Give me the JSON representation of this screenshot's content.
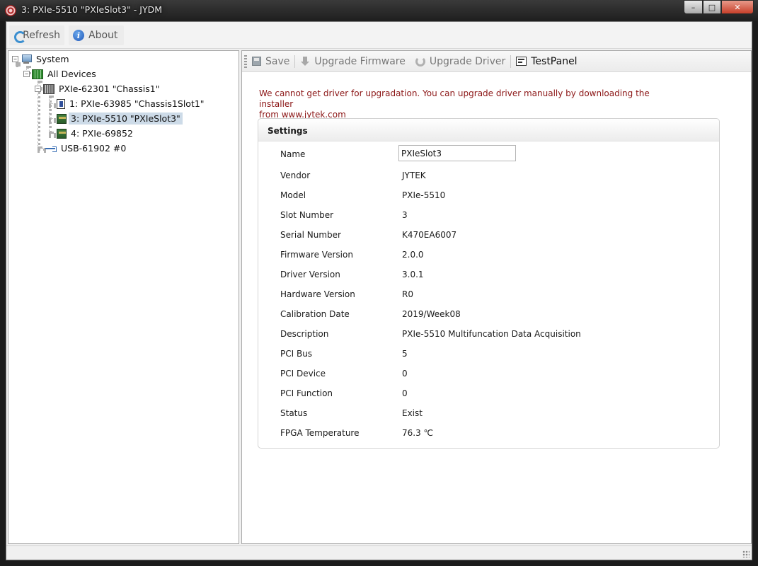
{
  "window": {
    "title": "3: PXIe-5510 \"PXIeSlot3\" - JYDM",
    "controls": {
      "minimize": "–",
      "maximize": "□",
      "close": "✕"
    }
  },
  "toolbar": {
    "refresh_label": "Refresh",
    "about_label": "About"
  },
  "tree": {
    "system": "System",
    "all_devices": "All Devices",
    "chassis": "PXIe-62301 \"Chassis1\"",
    "slot1": "1: PXIe-63985 \"Chassis1Slot1\"",
    "slot3": "3: PXIe-5510 \"PXIeSlot3\"",
    "slot4": "4: PXIe-69852",
    "usb": "USB-61902 #0",
    "expand_open": "−"
  },
  "device_toolbar": {
    "save_label": "Save",
    "upgrade_firmware_label": "Upgrade Firmware",
    "upgrade_driver_label": "Upgrade Driver",
    "testpanel_label": "TestPanel"
  },
  "warning": {
    "line1": "We cannot get driver for upgradation. You can upgrade driver manually by downloading the installer",
    "line2": "from www.jytek.com"
  },
  "settings": {
    "header": "Settings",
    "name_label": "Name",
    "name_value": "PXIeSlot3",
    "rows": [
      {
        "key": "Vendor",
        "value": "JYTEK"
      },
      {
        "key": "Model",
        "value": "PXIe-5510"
      },
      {
        "key": "Slot Number",
        "value": "3"
      },
      {
        "key": "Serial Number",
        "value": "K470EA6007"
      },
      {
        "key": "Firmware Version",
        "value": "2.0.0"
      },
      {
        "key": "Driver Version",
        "value": "3.0.1"
      },
      {
        "key": "Hardware Version",
        "value": "R0"
      },
      {
        "key": "Calibration Date",
        "value": "2019/Week08"
      },
      {
        "key": "Description",
        "value": "PXIe-5510 Multifuncation Data Acquisition"
      },
      {
        "key": "PCI Bus",
        "value": "5"
      },
      {
        "key": "PCI Device",
        "value": "0"
      },
      {
        "key": "PCI Function",
        "value": "0"
      },
      {
        "key": "Status",
        "value": "Exist"
      },
      {
        "key": "FPGA Temperature",
        "value": "76.3 ℃"
      }
    ]
  },
  "colors": {
    "warning_text": "#8b1515",
    "selection": "#cddbe8",
    "accent": "#3b8fd0"
  }
}
